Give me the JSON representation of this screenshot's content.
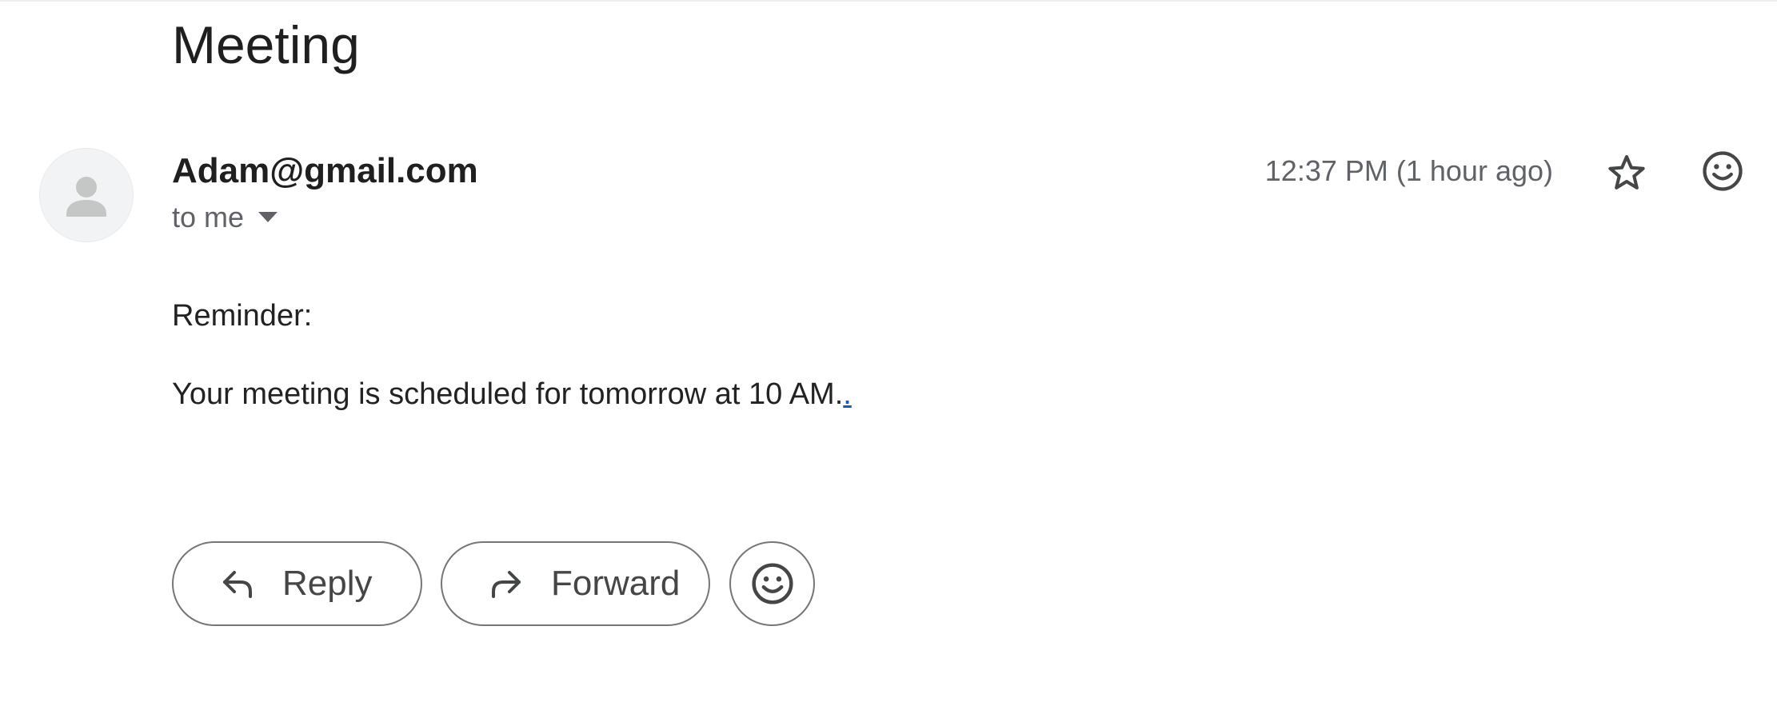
{
  "email": {
    "subject": "Meeting",
    "sender": "Adam@gmail.com",
    "recipient_label": "to me",
    "timestamp": "12:37 PM (1 hour ago)",
    "body": {
      "line1": "Reminder:",
      "line2": "Your meeting is scheduled for tomorrow at 10 AM.",
      "trailing_link": "."
    }
  },
  "actions": {
    "reply_label": "Reply",
    "forward_label": "Forward"
  },
  "icons": {
    "avatar": "person-icon",
    "recipient_toggle": "caret-down-icon",
    "star": "star-icon",
    "react": "emoji-icon",
    "reply": "reply-arrow-icon",
    "forward": "forward-arrow-icon"
  },
  "colors": {
    "text_primary": "#1f1f1f",
    "text_secondary": "#5f6368",
    "link": "#1a56c9",
    "button_border": "#747775"
  }
}
